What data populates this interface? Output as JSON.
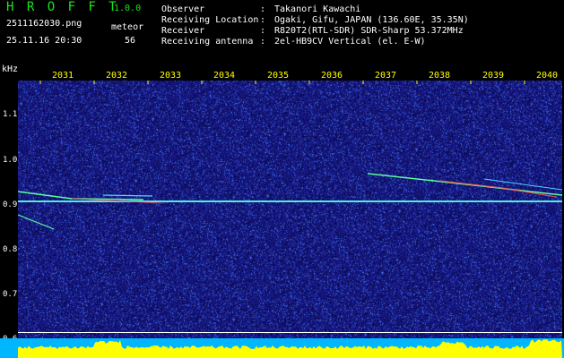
{
  "header": {
    "logo": "H R O F F T",
    "version": "1.0.0",
    "filename": "2511162030.png",
    "kind": "meteor",
    "datetime": "25.11.16 20:30",
    "count": "56"
  },
  "info": [
    {
      "label": "Observer",
      "value": "Takanori Kawachi"
    },
    {
      "label": "Receiving Location",
      "value": "Ogaki, Gifu, JAPAN (136.60E, 35.35N)"
    },
    {
      "label": "Receiver",
      "value": "R820T2(RTL-SDR) SDR-Sharp 53.372MHz"
    },
    {
      "label": "Receiving antenna",
      "value": "2el-HB9CV Vertical (el. E-W)"
    }
  ],
  "separator": ":",
  "axis": {
    "unit": "kHz",
    "y_ticks": [
      "1.1",
      "1.0",
      "0.9",
      "0.8",
      "0.7",
      "0.6"
    ],
    "x_ticks": [
      "2031",
      "2032",
      "2033",
      "2034",
      "2035",
      "2036",
      "2037",
      "2038",
      "2039",
      "2040"
    ]
  },
  "colors": {
    "background": "#000000",
    "header_text": "#19e619",
    "tick_text": "#ffff00",
    "spectrogram_bg": "#1a1a8c",
    "carrier": "#39e6ff",
    "amplitude": "#ffff00",
    "footer": "#00b6ff"
  }
}
